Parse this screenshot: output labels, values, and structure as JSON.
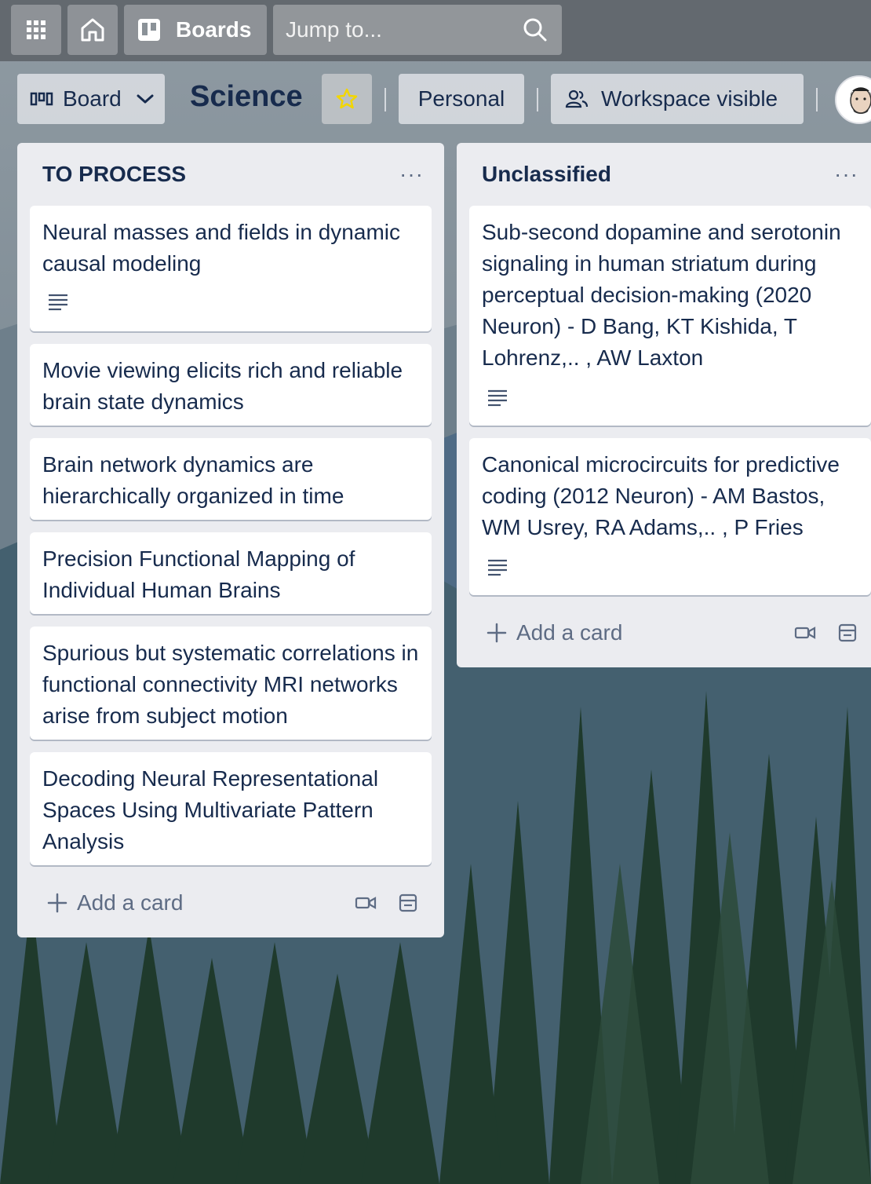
{
  "topbar": {
    "boards_label": "Boards",
    "search_placeholder": "Jump to..."
  },
  "board": {
    "view_label": "Board",
    "title": "Science",
    "visibility_workspace": "Personal",
    "visibility_label": "Workspace visible",
    "star_color": "#f2d600"
  },
  "lists": [
    {
      "title": "TO PROCESS",
      "menu": "···",
      "cards": [
        {
          "title": "Neural masses and fields in dynamic causal modeling",
          "has_description": true
        },
        {
          "title": "Movie viewing elicits rich and reliable brain state dynamics",
          "has_description": false
        },
        {
          "title": "Brain network dynamics are hierarchically organized in time",
          "has_description": false
        },
        {
          "title": "Precision Functional Mapping of Individual Human Brains",
          "has_description": false
        },
        {
          "title": "Spurious but systematic correlations in functional connectivity MRI networks arise from subject motion",
          "has_description": false
        },
        {
          "title": "Decoding Neural Representational Spaces Using Multivariate Pattern Analysis",
          "has_description": false
        }
      ],
      "add_card": "Add a card"
    },
    {
      "title": "Unclassified",
      "menu": "···",
      "cards": [
        {
          "title": "Sub-second dopamine and serotonin signaling in human striatum during perceptual decision-making (2020 Neuron) - D Bang, KT Kishida, T Lohrenz,.. , AW Laxton",
          "has_description": true
        },
        {
          "title": "Canonical microcircuits for predictive coding (2012 Neuron) - AM Bastos, WM Usrey, RA Adams,.. , P Fries",
          "has_description": true
        }
      ],
      "add_card": "Add a card"
    }
  ],
  "icons": {
    "apps": "apps-grid-icon",
    "home": "home-icon",
    "boards": "boards-icon",
    "search": "search-icon",
    "board_view": "board-view-icon",
    "chevron": "chevron-down-icon",
    "star": "star-icon",
    "workspace": "workspace-people-icon",
    "description": "description-icon",
    "plus": "plus-icon",
    "video": "video-icon",
    "template": "template-card-icon"
  }
}
